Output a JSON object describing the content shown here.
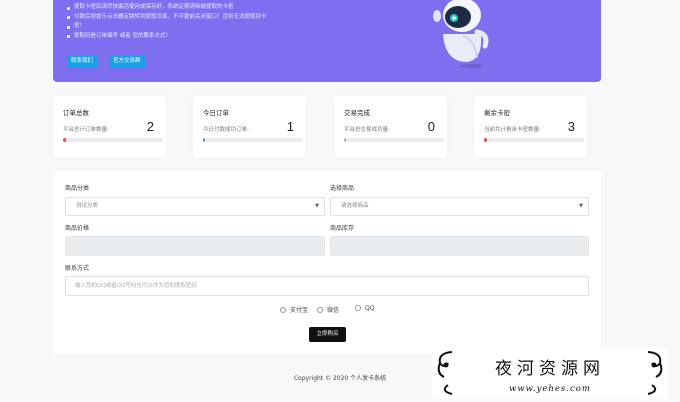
{
  "notice": {
    "lines": [
      "提取卡密后请尽快激活使用或保存好，系统定期清除被提取的卡密",
      "付款后按提示点击确定跳转到提取页面，不可提前关闭窗口！否则无法提取到卡",
      "密！",
      "提取码是订单编号 或者 您的联系方式！"
    ],
    "btn_contact": "联系我们",
    "btn_group": "官方交流群"
  },
  "stats": [
    {
      "title": "订单总数",
      "label": "平台总计订单数量:",
      "value": "2",
      "progress": 0.03,
      "color": "#e74c3c"
    },
    {
      "title": "今日订单",
      "label": "今日付款成功订单:",
      "value": "1",
      "progress": 0.015,
      "color": "#3b8de6"
    },
    {
      "title": "交易完成",
      "label": "平台总交易成功量:",
      "value": "0",
      "progress": 0.02,
      "color": "#aab0b8"
    },
    {
      "title": "剩余卡密",
      "label": "当前共计剩余卡密数量:",
      "value": "3",
      "progress": 0.03,
      "color": "#e74c3c"
    }
  ],
  "form": {
    "category_label": "商品分类",
    "category_value": "测试分类",
    "product_label": "选择商品",
    "product_placeholder": "请选择商品",
    "price_label": "商品价格",
    "stock_label": "商品库存",
    "contact_label": "联系方式",
    "contact_placeholder": "输入您的QQ或者QQ号码也可以作为您的提取密码",
    "payments": [
      "支付宝",
      "微信",
      "QQ"
    ],
    "buy_label": "立即购买"
  },
  "footer": "Copyright © 2020 个人发卡系统",
  "watermark": {
    "title": "夜河资源网",
    "url": "www.yehes.com"
  }
}
